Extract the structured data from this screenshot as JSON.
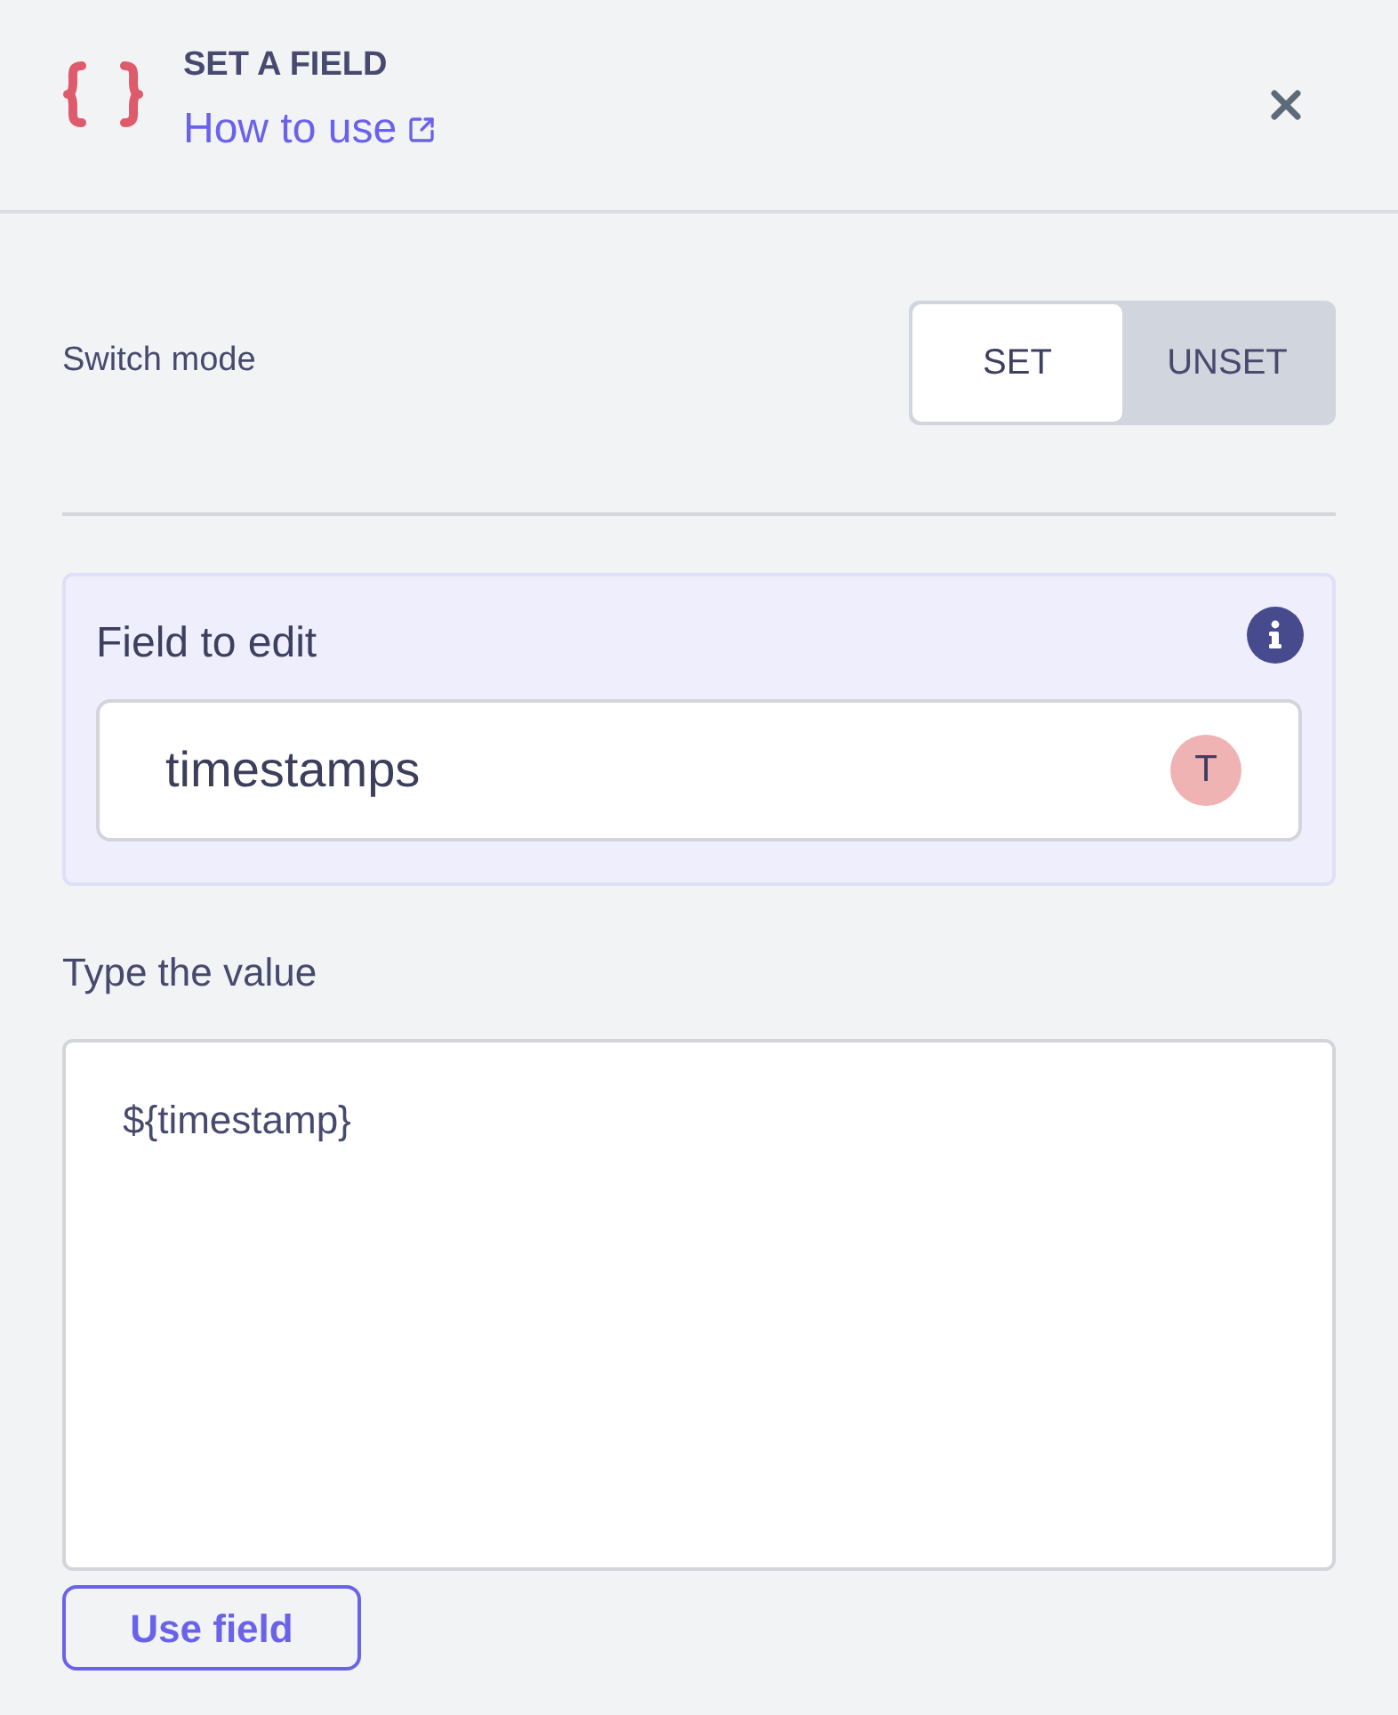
{
  "header": {
    "title": "SET A FIELD",
    "link": "How to use"
  },
  "mode": {
    "label": "Switch mode",
    "options": [
      {
        "label": "SET",
        "selected": true
      },
      {
        "label": "UNSET",
        "selected": false
      }
    ]
  },
  "field_to_edit": {
    "label": "Field to edit",
    "value": "timestamps",
    "type_badge": "T"
  },
  "value_input": {
    "label": "Type the value",
    "value": "${timestamp}"
  },
  "buttons": [
    {
      "label": "Use field"
    }
  ]
}
